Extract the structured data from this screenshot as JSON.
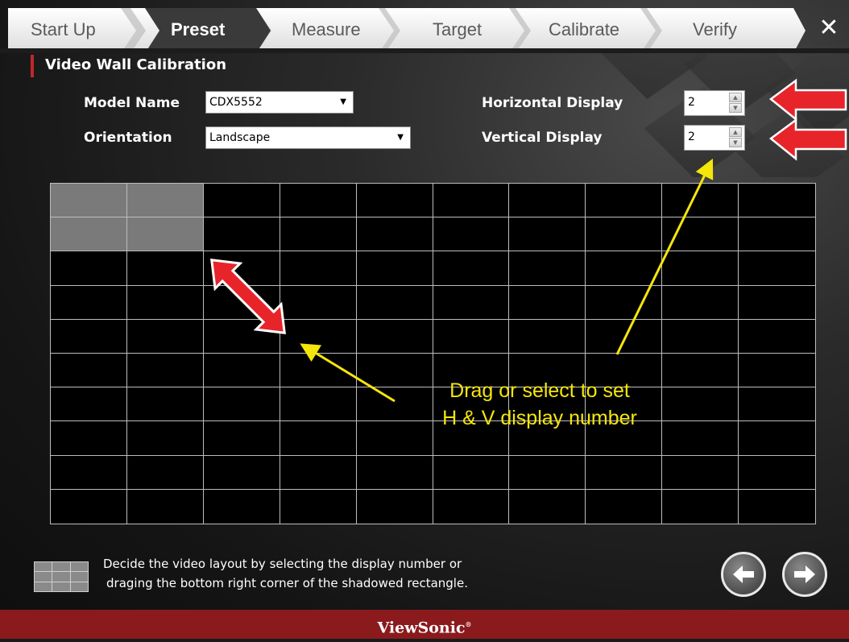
{
  "steps": [
    {
      "label": "Start Up",
      "active": false
    },
    {
      "label": "Preset",
      "active": true
    },
    {
      "label": "Measure",
      "active": false
    },
    {
      "label": "Target",
      "active": false
    },
    {
      "label": "Calibrate",
      "active": false
    },
    {
      "label": "Verify",
      "active": false
    }
  ],
  "close_icon": "close-icon",
  "section_title": "Video Wall Calibration",
  "form": {
    "model_name_label": "Model Name",
    "model_name_value": "CDX5552",
    "orientation_label": "Orientation",
    "orientation_value": "Landscape",
    "horizontal_label": "Horizontal Display",
    "horizontal_value": "2",
    "vertical_label": "Vertical Display",
    "vertical_value": "2"
  },
  "grid": {
    "columns": 10,
    "rows": 10,
    "selected_columns": 2,
    "selected_rows": 2
  },
  "annotation": {
    "line1": "Drag or select to set",
    "line2": "H & V display number"
  },
  "hint": {
    "line1": "Decide the video layout by selecting the display number or",
    "line2": "draging the bottom right corner of the shadowed rectangle."
  },
  "nav": {
    "back_icon": "arrow-left-icon",
    "next_icon": "arrow-right-icon"
  },
  "footer": {
    "brand": "ViewSonic"
  },
  "colors": {
    "brand_red": "#8b1a1d",
    "accent_red": "#c0272d",
    "annotation_yellow": "#f5e60a"
  }
}
